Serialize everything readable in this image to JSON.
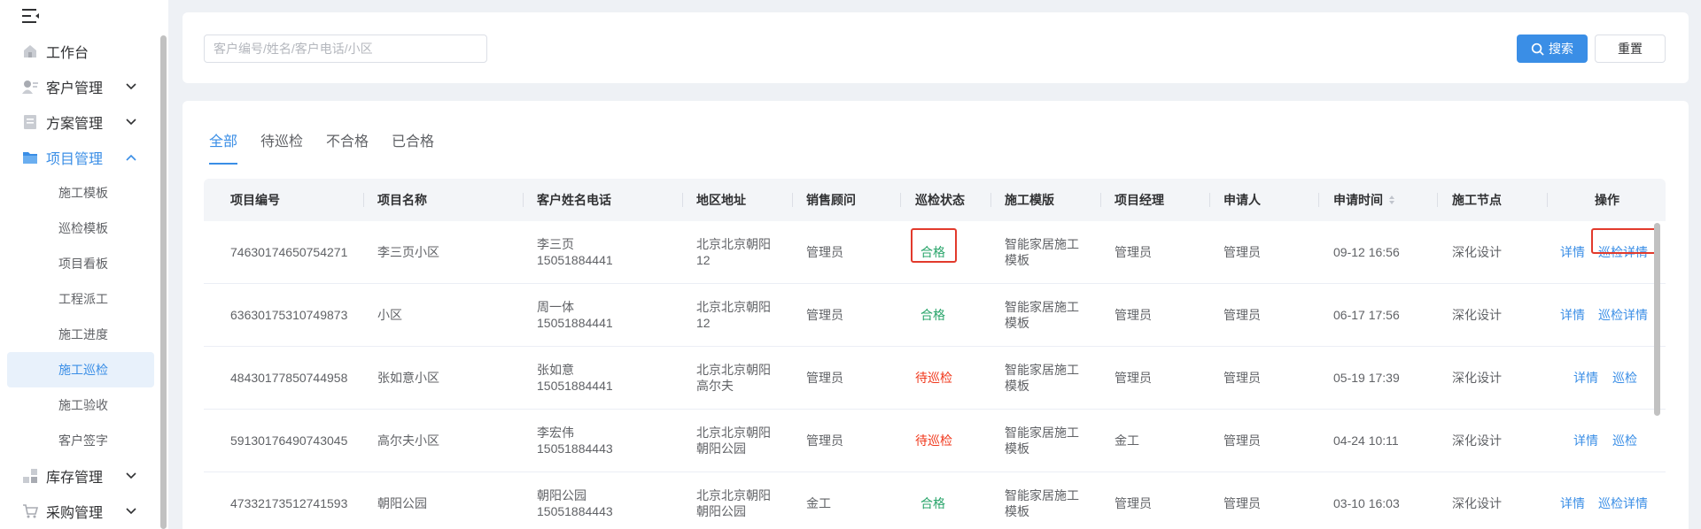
{
  "sidebar": {
    "items": [
      {
        "label": "工作台",
        "icon": "home-icon"
      },
      {
        "label": "客户管理",
        "icon": "customer-icon"
      },
      {
        "label": "方案管理",
        "icon": "document-icon"
      },
      {
        "label": "项目管理",
        "icon": "folder-icon"
      },
      {
        "label": "库存管理",
        "icon": "inventory-icon"
      },
      {
        "label": "采购管理",
        "icon": "cart-icon"
      }
    ],
    "sub_items": [
      "施工模板",
      "巡检模板",
      "项目看板",
      "工程派工",
      "施工进度",
      "施工巡检",
      "施工验收",
      "客户签字"
    ]
  },
  "search": {
    "placeholder": "客户编号/姓名/客户电话/小区",
    "search_label": "搜索",
    "reset_label": "重置"
  },
  "tabs": [
    "全部",
    "待巡检",
    "不合格",
    "已合格"
  ],
  "table": {
    "headers": [
      "项目编号",
      "项目名称",
      "客户姓名电话",
      "地区地址",
      "销售顾问",
      "巡检状态",
      "施工模版",
      "项目经理",
      "申请人",
      "申请时间",
      "施工节点",
      "操作"
    ],
    "rows": [
      {
        "id": "74630174650754271",
        "name": "李三页小区",
        "cust_name": "李三页",
        "cust_phone": "15051884441",
        "addr1": "北京北京朝阳",
        "addr2": "12",
        "sales": "管理员",
        "status": "合格",
        "tpl1": "智能家居施工",
        "tpl2": "模板",
        "pm": "管理员",
        "applicant": "管理员",
        "time": "09-12 16:56",
        "node": "深化设计",
        "op1": "详情",
        "op2": "巡检详情"
      },
      {
        "id": "63630175310749873",
        "name": "小区",
        "cust_name": "周一体",
        "cust_phone": "15051884441",
        "addr1": "北京北京朝阳",
        "addr2": "12",
        "sales": "管理员",
        "status": "合格",
        "tpl1": "智能家居施工",
        "tpl2": "模板",
        "pm": "管理员",
        "applicant": "管理员",
        "time": "06-17 17:56",
        "node": "深化设计",
        "op1": "详情",
        "op2": "巡检详情"
      },
      {
        "id": "48430177850744958",
        "name": "张如意小区",
        "cust_name": "张如意",
        "cust_phone": "15051884441",
        "addr1": "北京北京朝阳",
        "addr2": "高尔夫",
        "sales": "管理员",
        "status": "待巡检",
        "tpl1": "智能家居施工",
        "tpl2": "模板",
        "pm": "管理员",
        "applicant": "管理员",
        "time": "05-19 17:39",
        "node": "深化设计",
        "op1": "详情",
        "op2": "巡检"
      },
      {
        "id": "59130176490743045",
        "name": "高尔夫小区",
        "cust_name": "李宏伟",
        "cust_phone": "15051884443",
        "addr1": "北京北京朝阳",
        "addr2": "朝阳公园",
        "sales": "管理员",
        "status": "待巡检",
        "tpl1": "智能家居施工",
        "tpl2": "模板",
        "pm": "金工",
        "applicant": "管理员",
        "time": "04-24 10:11",
        "node": "深化设计",
        "op1": "详情",
        "op2": "巡检"
      },
      {
        "id": "47332173512741593",
        "name": "朝阳公园",
        "cust_name": "朝阳公园",
        "cust_phone": "15051884443",
        "addr1": "北京北京朝阳",
        "addr2": "朝阳公园",
        "sales": "金工",
        "status": "合格",
        "tpl1": "智能家居施工",
        "tpl2": "模板",
        "pm": "管理员",
        "applicant": "管理员",
        "time": "03-10 16:03",
        "node": "深化设计",
        "op1": "详情",
        "op2": "巡检详情"
      }
    ]
  },
  "colors": {
    "accent": "#3a8ee6",
    "ok": "#2aa56b",
    "wait": "#f0371b",
    "highlight": "#e23a2c"
  }
}
